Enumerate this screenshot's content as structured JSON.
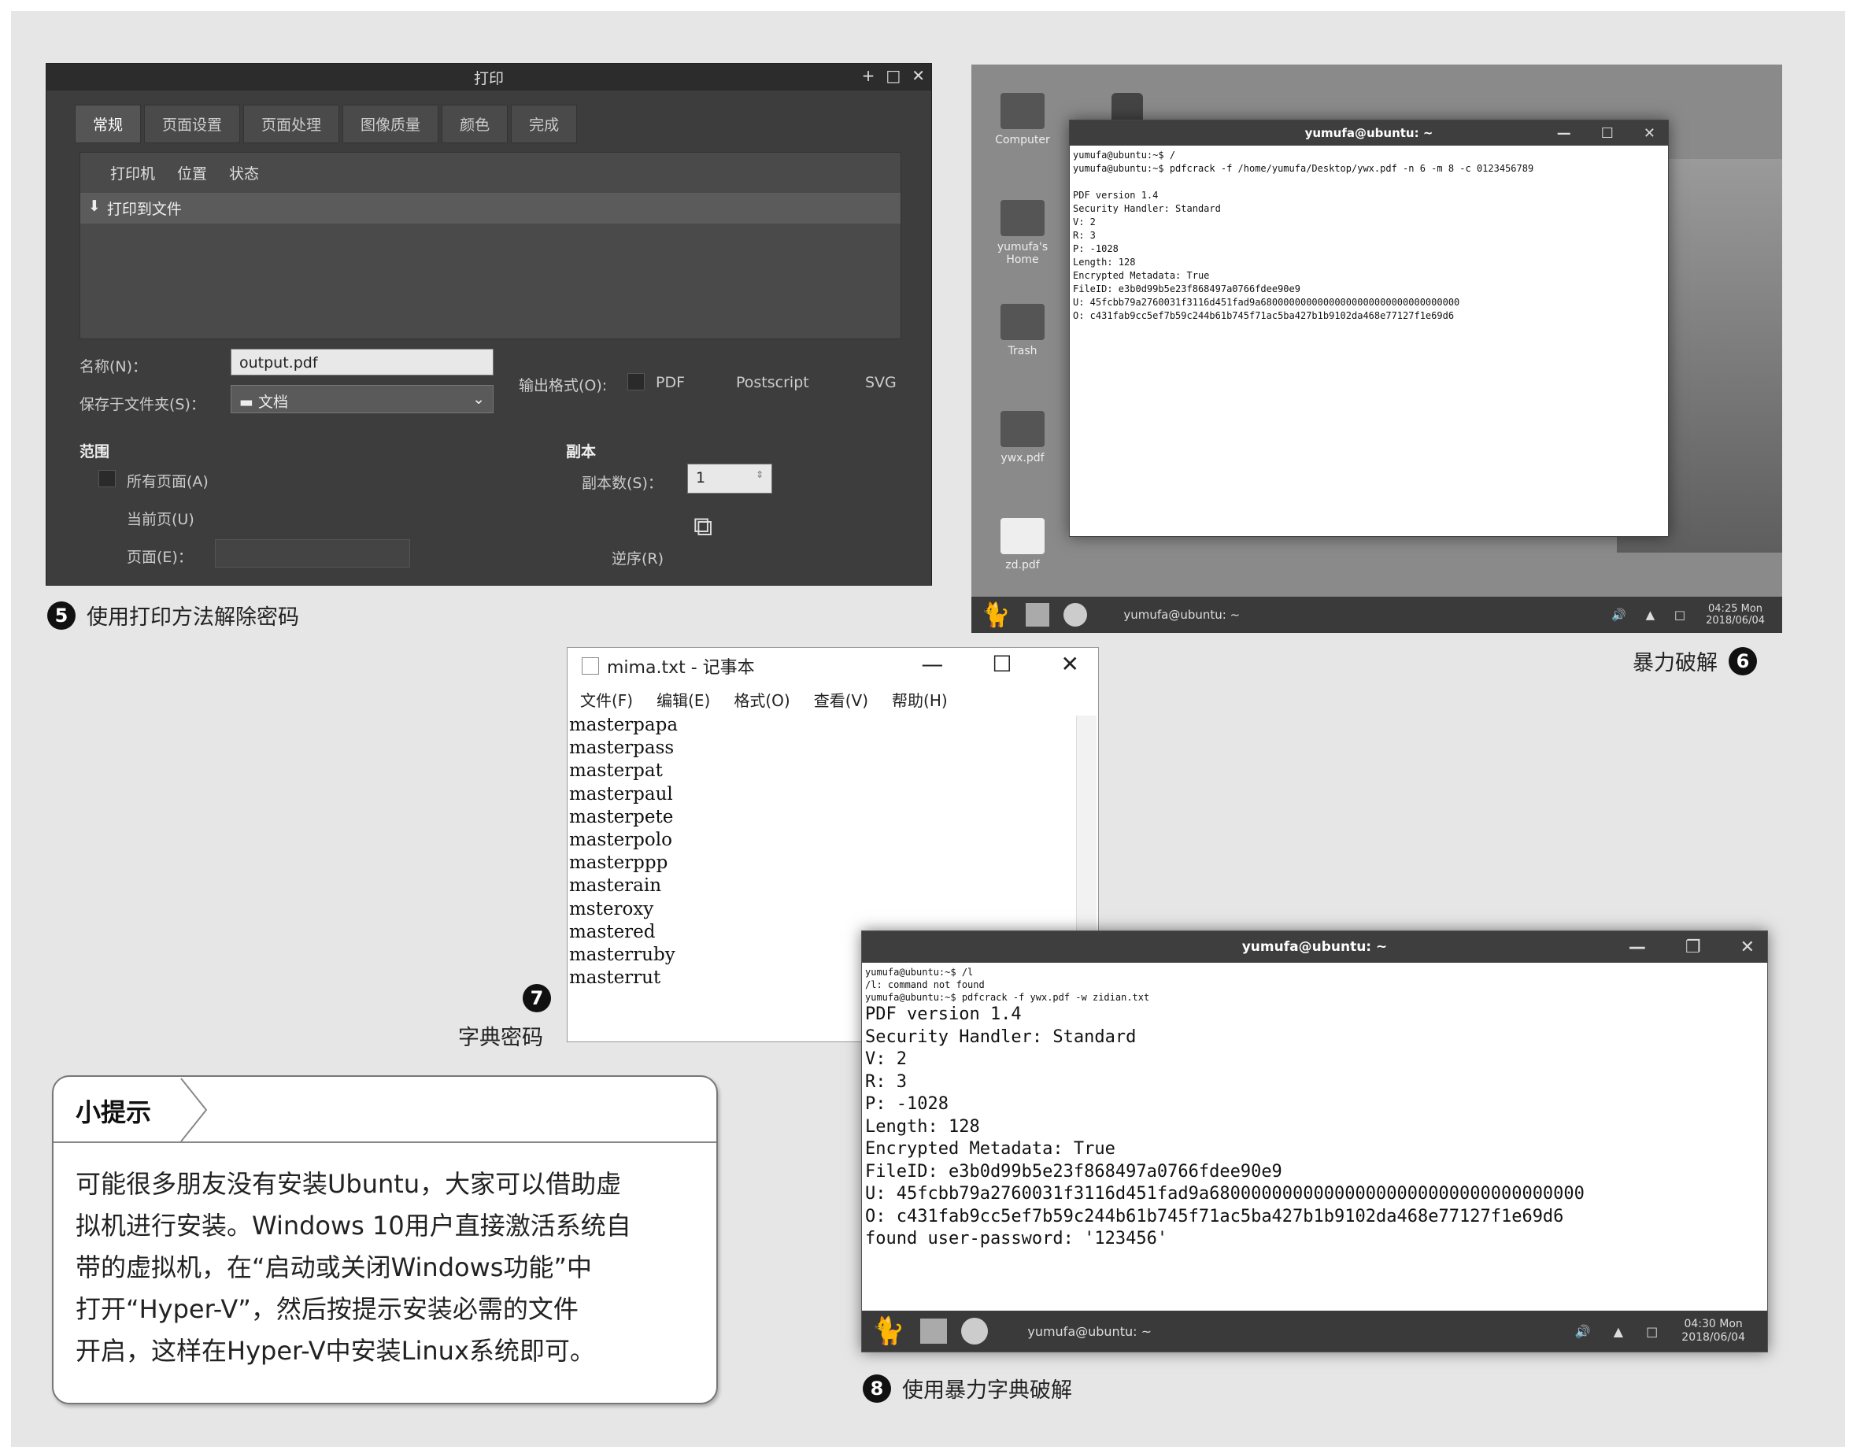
{
  "print_dialog": {
    "title": "打印",
    "controls": [
      "+",
      "□",
      "✕"
    ],
    "tabs": [
      "常规",
      "页面设置",
      "页面处理",
      "图像质量",
      "颜色",
      "完成"
    ],
    "printer_list": {
      "headers": [
        "打印机",
        "位置",
        "状态"
      ],
      "rows": [
        "打印到文件"
      ]
    },
    "name_label": "名称(N)：",
    "name_value": "output.pdf",
    "folder_label": "保存于文件夹(S)：",
    "folder_value": "文档",
    "output_format_label": "输出格式(O):",
    "formats": [
      "PDF",
      "Postscript",
      "SVG"
    ],
    "range_title": "范围",
    "range_all": "所有页面(A)",
    "range_current": "当前页(U)",
    "range_pages": "页面(E)：",
    "copies_title": "副本",
    "copies_label": "副本数(S)：",
    "copies_value": "1",
    "collate_label": "逆序(R)"
  },
  "caption5": {
    "num": "5",
    "text": "使用打印方法解除密码"
  },
  "desktop6": {
    "icons": [
      "Computer",
      "yumufa's Home",
      "Trash",
      "ywx.pdf",
      "zd.pdf"
    ],
    "terminal_title": "yumufa@ubuntu: ~",
    "lines": [
      "yumufa@ubuntu:~$ /",
      "yumufa@ubuntu:~$ pdfcrack -f /home/yumufa/Desktop/ywx.pdf -n 6 -m 8 -c 0123456789",
      "",
      "PDF version 1.4",
      "Security Handler: Standard",
      "V: 2",
      "R: 3",
      "P: -1028",
      "Length: 128",
      "Encrypted Metadata: True",
      "FileID: e3b0d99b5e23f868497a0766fdee90e9",
      "U: 45fcbb79a2760031f3116d451fad9a68000000000000000000000000000000000",
      "O: c431fab9cc5ef7b59c244b61b745f71ac5ba427b1b9102da468e77127f1e69d6"
    ],
    "taskbar_item": "yumufa@ubuntu: ~",
    "clock_time": "04:25 Mon",
    "clock_date": "2018/06/04"
  },
  "caption6": {
    "num": "6",
    "text": "暴力破解"
  },
  "notepad": {
    "title": "mima.txt - 记事本",
    "controls": [
      "—",
      "☐",
      "✕"
    ],
    "menu": [
      "文件(F)",
      "编辑(E)",
      "格式(O)",
      "查看(V)",
      "帮助(H)"
    ],
    "lines": [
      "masterpapa",
      "masterpass",
      "masterpat",
      "masterpaul",
      "masterpete",
      "masterpolo",
      "masterppp",
      "masterain",
      "msteroxy",
      "mastered",
      "masterruby",
      "masterrut"
    ]
  },
  "caption7": {
    "num": "7",
    "text": "字典密码"
  },
  "terminal8": {
    "title": "yumufa@ubuntu: ~",
    "small_lines": [
      "yumufa@ubuntu:~$ /l",
      "/l: command not found",
      "yumufa@ubuntu:~$ pdfcrack -f ywx.pdf -w zidian.txt"
    ],
    "lines": [
      "PDF version 1.4",
      "Security Handler: Standard",
      "V: 2",
      "R: 3",
      "P: -1028",
      "Length: 128",
      "Encrypted Metadata: True",
      "FileID: e3b0d99b5e23f868497a0766fdee90e9",
      "U: 45fcbb79a2760031f3116d451fad9a680000000000000000000000000000000000",
      "O: c431fab9cc5ef7b59c244b61b745f71ac5ba427b1b9102da468e77127f1e69d6",
      "found user-password: '123456'"
    ],
    "taskbar_item": "yumufa@ubuntu: ~",
    "clock_time": "04:30 Mon",
    "clock_date": "2018/06/04"
  },
  "caption8": {
    "num": "8",
    "text": "使用暴力字典破解"
  },
  "tip": {
    "title": "小提示",
    "lines": [
      "可能很多朋友没有安装Ubuntu，大家可以借助虚",
      "拟机进行安装。Windows 10用户直接激活系统自",
      "带的虚拟机，在“启动或关闭Windows功能”中",
      "打开“Hyper-V”，然后按提示安装必需的文件",
      "开启，这样在Hyper-V中安装Linux系统即可。"
    ]
  }
}
